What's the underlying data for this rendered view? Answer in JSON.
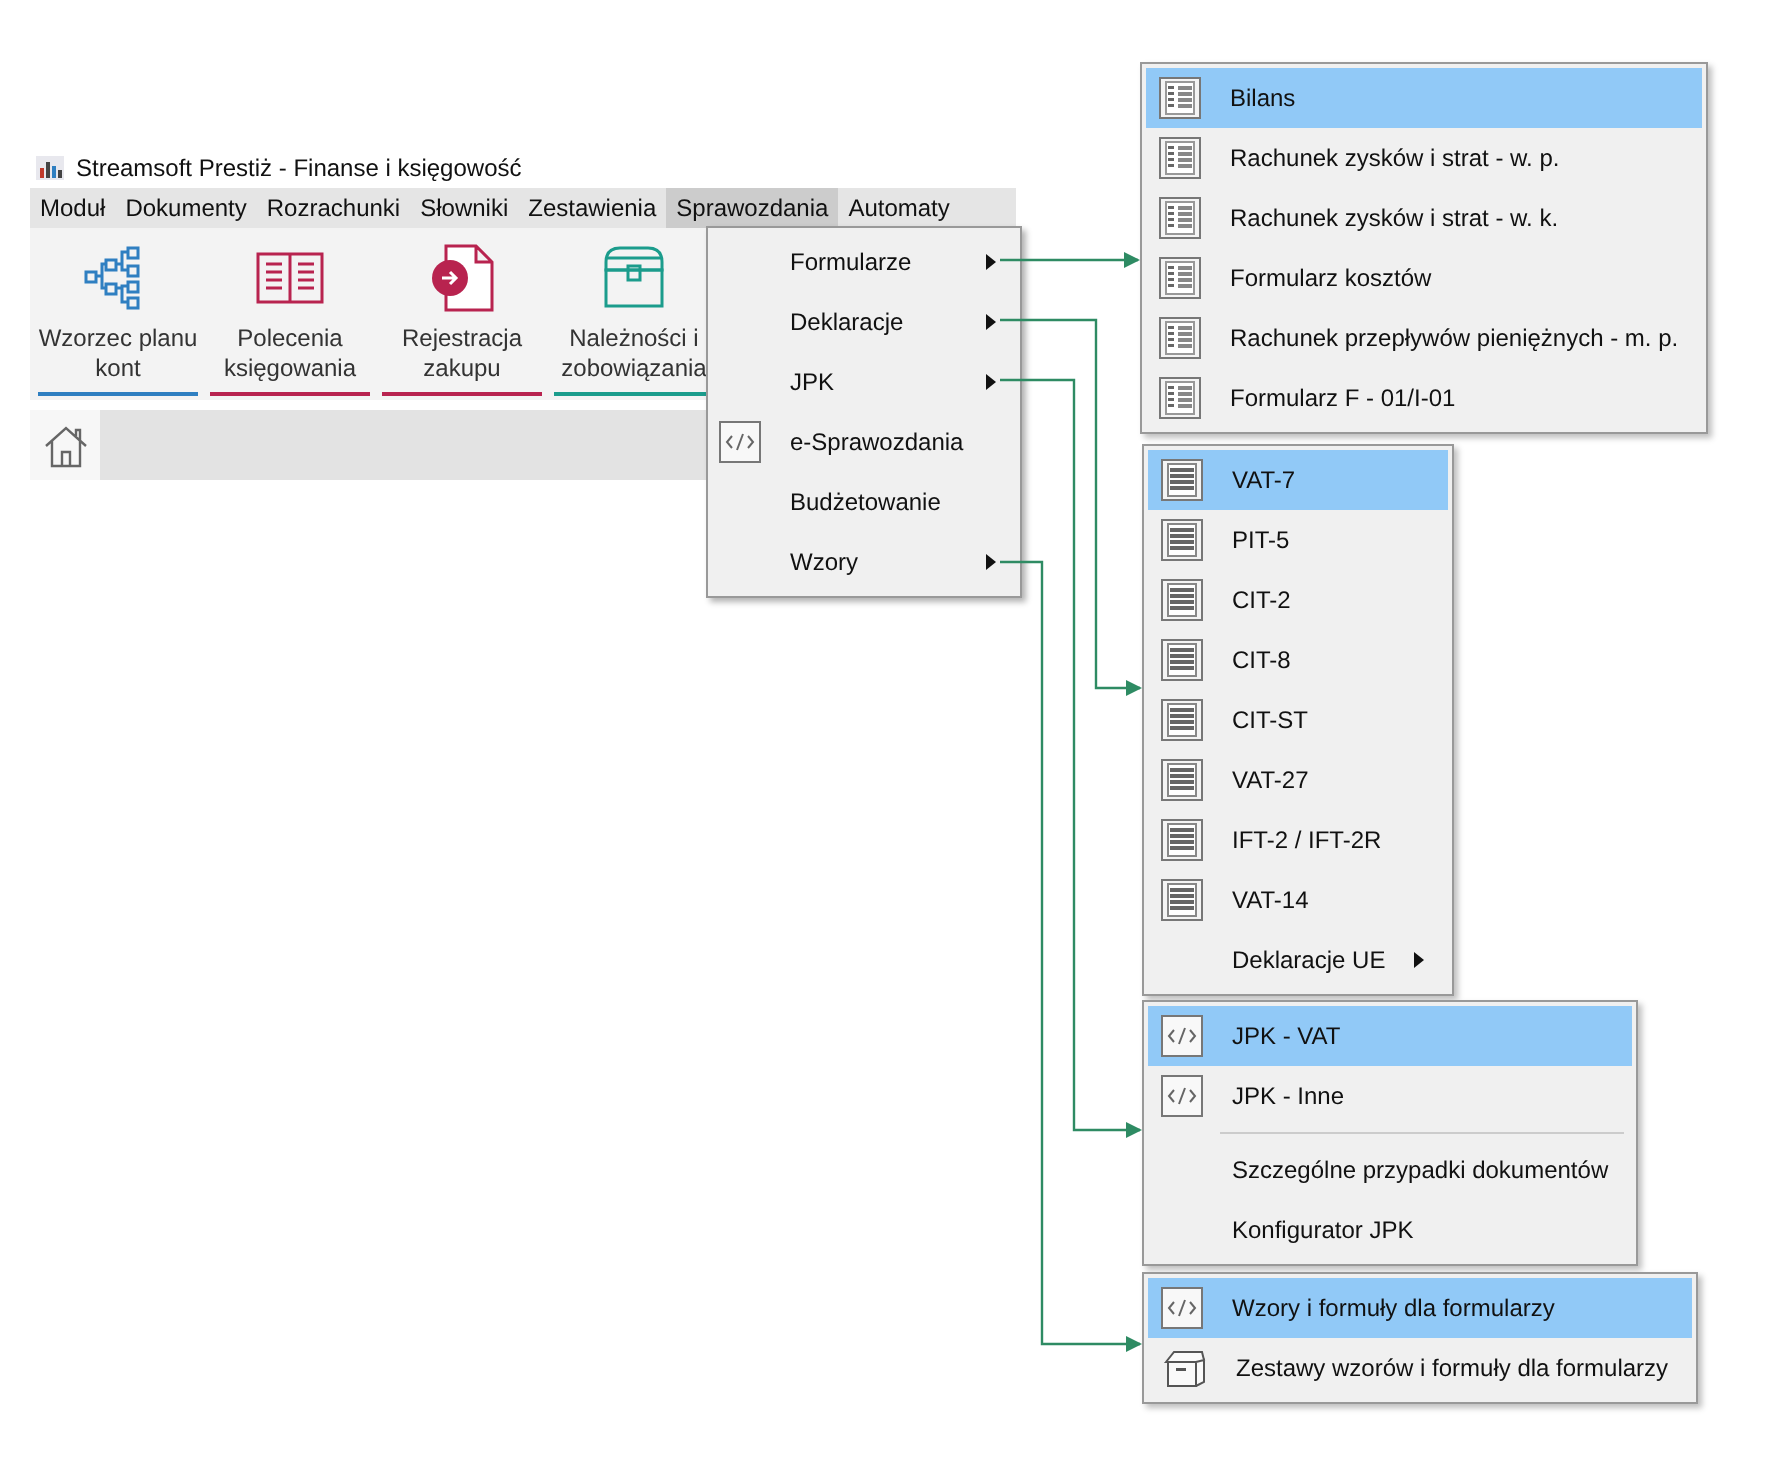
{
  "window": {
    "title": "Streamsoft Prestiż - Finanse i księgowość"
  },
  "menu_bar": [
    {
      "label": "Moduł",
      "selected": false
    },
    {
      "label": "Dokumenty",
      "selected": false
    },
    {
      "label": "Rozrachunki",
      "selected": false
    },
    {
      "label": "Słowniki",
      "selected": false
    },
    {
      "label": "Zestawienia",
      "selected": false
    },
    {
      "label": "Sprawozdania",
      "selected": true
    },
    {
      "label": "Automaty",
      "selected": false
    }
  ],
  "ribbon": [
    {
      "label": "Wzorzec planu kont",
      "kind": "hierarchy",
      "color": "#2f7fc1"
    },
    {
      "label": "Polecenia księgowania",
      "kind": "book",
      "color": "#b8234f"
    },
    {
      "label": "Rejestracja zakupu",
      "kind": "document",
      "color": "#b8234f"
    },
    {
      "label": "Należności i zobowiązania",
      "kind": "chest",
      "color": "#1b9c8c"
    }
  ],
  "dropdown": {
    "items": [
      {
        "label": "Formularze",
        "kind": "submenu"
      },
      {
        "label": "Deklaracje",
        "kind": "submenu"
      },
      {
        "label": "JPK",
        "kind": "submenu"
      },
      {
        "label": "e-Sprawozdania",
        "kind": "code"
      },
      {
        "label": "Budżetowanie",
        "kind": "plain"
      },
      {
        "label": "Wzory",
        "kind": "submenu"
      }
    ]
  },
  "submenus": [
    {
      "items": [
        {
          "kind": "form",
          "label": "Bilans",
          "selected": true
        },
        {
          "kind": "form",
          "label": "Rachunek zysków i strat - w. p.",
          "selected": false
        },
        {
          "kind": "form",
          "label": "Rachunek zysków i strat - w. k.",
          "selected": false
        },
        {
          "kind": "form",
          "label": "Formularz kosztów",
          "selected": false
        },
        {
          "kind": "form",
          "label": "Rachunek przepływów pieniężnych - m. p.",
          "selected": false
        },
        {
          "kind": "form",
          "label": "Formularz F - 01/I-01",
          "selected": false
        }
      ]
    },
    {
      "items": [
        {
          "kind": "table",
          "label": "VAT-7",
          "selected": true
        },
        {
          "kind": "table",
          "label": "PIT-5",
          "selected": false
        },
        {
          "kind": "table",
          "label": "CIT-2",
          "selected": false
        },
        {
          "kind": "table",
          "label": "CIT-8",
          "selected": false
        },
        {
          "kind": "table",
          "label": "CIT-ST",
          "selected": false
        },
        {
          "kind": "table",
          "label": "VAT-27",
          "selected": false
        },
        {
          "kind": "table",
          "label": "IFT-2 / IFT-2R",
          "selected": false
        },
        {
          "kind": "table",
          "label": "VAT-14",
          "selected": false
        },
        {
          "kind": "submenu",
          "label": "Deklaracje UE",
          "selected": false
        }
      ]
    },
    {
      "items": [
        {
          "kind": "code",
          "label": "JPK - VAT",
          "selected": true
        },
        {
          "kind": "code",
          "label": "JPK - Inne",
          "selected": false
        },
        {
          "kind": "separator"
        },
        {
          "kind": "plain",
          "label": "Szczególne przypadki dokumentów",
          "selected": false
        },
        {
          "kind": "plain",
          "label": "Konfigurator JPK",
          "selected": false
        }
      ]
    },
    {
      "items": [
        {
          "kind": "code",
          "label": "Wzory i formuły dla formularzy",
          "selected": true
        },
        {
          "kind": "box",
          "label": "Zestawy wzorów i formuły dla formularzy",
          "selected": false
        }
      ]
    }
  ]
}
